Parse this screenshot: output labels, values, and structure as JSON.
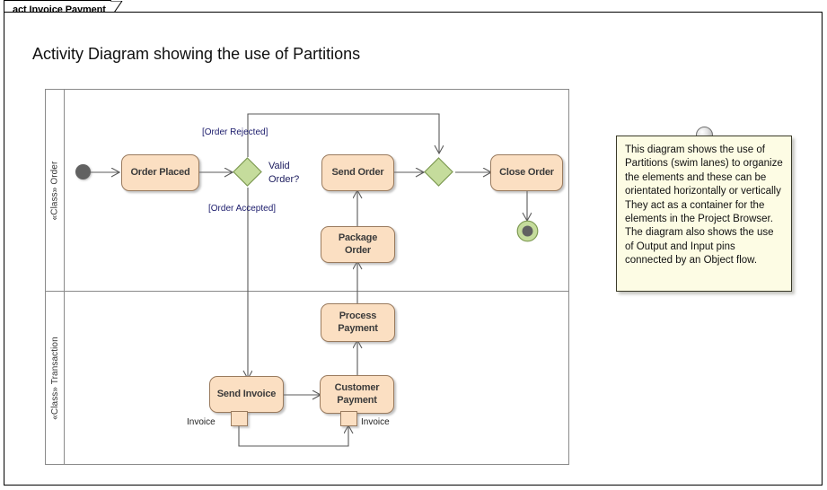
{
  "window": {
    "tab_label": "act Invoice Payment"
  },
  "diagram": {
    "title": "Activity Diagram showing the use of Partitions",
    "partitions": [
      {
        "id": "order",
        "label": "«Class» Order"
      },
      {
        "id": "transaction",
        "label": "«Class» Transaction"
      }
    ],
    "nodes": {
      "order_placed": "Order Placed",
      "send_order": "Send Order",
      "close_order": "Close Order",
      "package_order": "Package Order",
      "process_payment": "Process Payment",
      "send_invoice": "Send Invoice",
      "customer_payment": "Customer Payment"
    },
    "decision": {
      "label": "Valid Order?",
      "label_line1": "Valid",
      "label_line2": "Order?"
    },
    "guards": {
      "rejected": "[Order Rejected]",
      "accepted": "[Order Accepted]"
    },
    "pins": {
      "output_invoice": "Invoice",
      "input_invoice": "Invoice"
    },
    "colors": {
      "activity_fill": "#FBDFC2",
      "activity_border": "#9A7B5E",
      "decision_fill": "#C5DC9C",
      "decision_border": "#7E9A53",
      "final_outer": "#C5DC9C",
      "final_inner": "#616161",
      "initial_fill": "#616161",
      "note_fill": "#FDFCE4",
      "note_border": "#3A3A28",
      "lane_border": "#8A8A8A",
      "connector": "#5A5A5A"
    }
  },
  "note": {
    "text": "This diagram shows the use of Partitions (swim lanes) to organize the elements and these can be orientated horizontally or vertically  They act as a container for the elements in the Project Browser. The diagram also shows the use of Output and Input pins connected by an Object flow."
  }
}
